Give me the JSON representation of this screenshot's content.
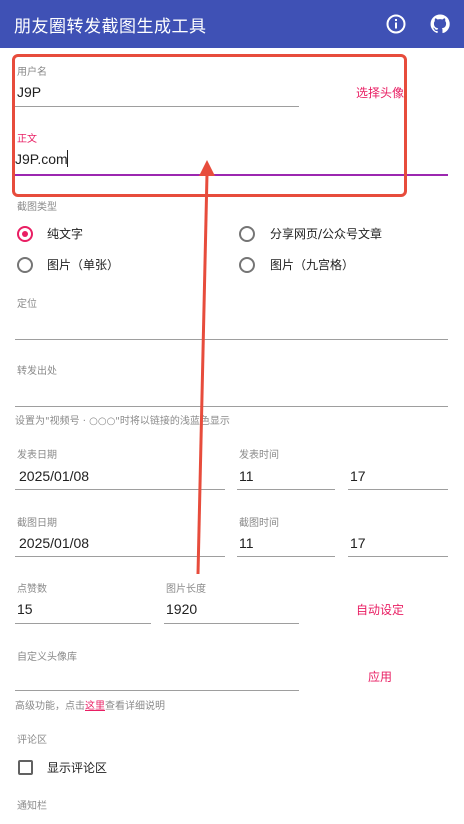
{
  "app": {
    "title": "朋友圈转发截图生成工具",
    "info_icon": "info-icon",
    "github_icon": "github-icon"
  },
  "username": {
    "label": "用户名",
    "value": "J9P",
    "choose_avatar": "选择头像"
  },
  "content": {
    "label": "正文",
    "value": "J9P.com"
  },
  "screenshot_type": {
    "label": "截图类型",
    "options": [
      {
        "label": "纯文字",
        "checked": true
      },
      {
        "label": "分享网页/公众号文章",
        "checked": false
      },
      {
        "label": "图片（单张）",
        "checked": false
      },
      {
        "label": "图片（九宫格）",
        "checked": false
      }
    ]
  },
  "location": {
    "label": "定位",
    "value": ""
  },
  "forward_source": {
    "label": "转发出处",
    "value": "",
    "hint": "设置为\"视频号 · ○○○\"时将以链接的浅蓝色显示"
  },
  "publish": {
    "date_label": "发表日期",
    "date_value": "2025/01/08",
    "time_label": "发表时间",
    "hour": "11",
    "minute": "17"
  },
  "capture": {
    "date_label": "截图日期",
    "date_value": "2025/01/08",
    "time_label": "截图时间",
    "hour": "11",
    "minute": "17"
  },
  "likes": {
    "label": "点赞数",
    "value": "15"
  },
  "image_length": {
    "label": "图片长度",
    "value": "1920",
    "auto_set": "自动设定"
  },
  "custom_avatar": {
    "label": "自定义头像库",
    "value": "",
    "apply": "应用",
    "hint_prefix": "高级功能，点击",
    "hint_link": "这里",
    "hint_suffix": "查看详细说明"
  },
  "comments": {
    "label": "评论区",
    "checkbox_label": "显示评论区",
    "checked": false
  },
  "notification": {
    "label": "通知栏"
  },
  "colors": {
    "appbar": "#3f51b5",
    "accent": "#e91e63",
    "annotation": "#e74c3c"
  }
}
